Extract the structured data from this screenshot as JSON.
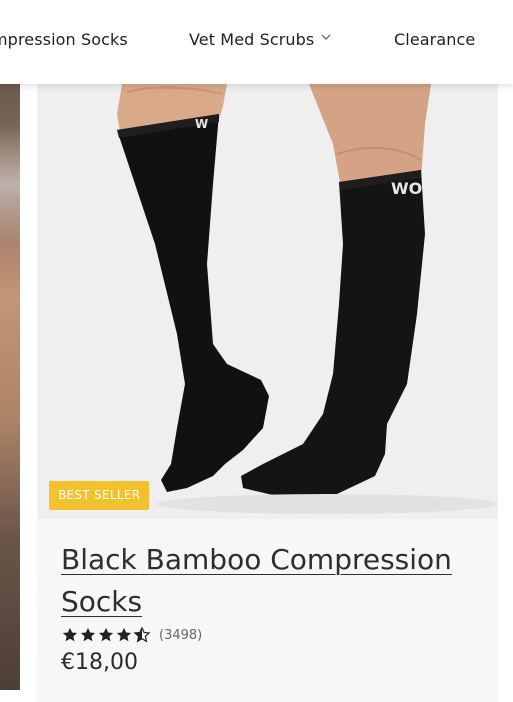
{
  "nav": {
    "items": [
      {
        "label": "mpression Socks"
      },
      {
        "label": "Vet Med Scrubs",
        "icon": "chevron-down-icon"
      },
      {
        "label": "Clearance"
      }
    ]
  },
  "product": {
    "badge": "BEST SELLER",
    "title": "Black Bamboo Compression Socks",
    "rating_stars": 4.5,
    "review_count": "(3498)",
    "price": "€18,00",
    "sock_logo_text": "WO"
  },
  "colors": {
    "badge": "#f2c12e",
    "card_background": "#f7f7f7",
    "sock": "#111111",
    "skin": "#d9a98a"
  }
}
